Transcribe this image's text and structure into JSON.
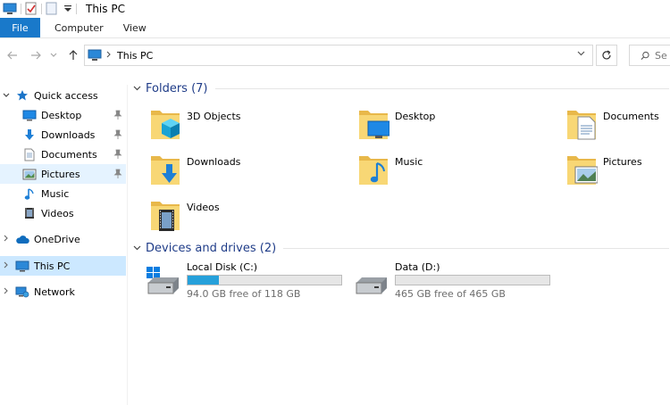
{
  "window": {
    "title": "This PC"
  },
  "ribbon": {
    "tabs": [
      {
        "label": "File"
      },
      {
        "label": "Computer"
      },
      {
        "label": "View"
      }
    ]
  },
  "address": {
    "path": "This PC",
    "search_placeholder": "Se"
  },
  "sidebar": {
    "quick_access": "Quick access",
    "items": [
      {
        "label": "Desktop",
        "icon": "desktop-icon",
        "pinned": true
      },
      {
        "label": "Downloads",
        "icon": "downloads-icon",
        "pinned": true
      },
      {
        "label": "Documents",
        "icon": "documents-icon",
        "pinned": true
      },
      {
        "label": "Pictures",
        "icon": "pictures-icon",
        "pinned": true
      },
      {
        "label": "Music",
        "icon": "music-icon",
        "pinned": false
      },
      {
        "label": "Videos",
        "icon": "videos-icon",
        "pinned": false
      }
    ],
    "onedrive": "OneDrive",
    "this_pc": "This PC",
    "network": "Network"
  },
  "folders_group": {
    "title": "Folders (7)",
    "items": [
      {
        "label": "3D Objects",
        "icon": "3d-objects-icon"
      },
      {
        "label": "Desktop",
        "icon": "desktop-folder-icon"
      },
      {
        "label": "Documents",
        "icon": "documents-folder-icon"
      },
      {
        "label": "Downloads",
        "icon": "downloads-folder-icon"
      },
      {
        "label": "Music",
        "icon": "music-folder-icon"
      },
      {
        "label": "Pictures",
        "icon": "pictures-folder-icon"
      },
      {
        "label": "Videos",
        "icon": "videos-folder-icon"
      }
    ]
  },
  "drives_group": {
    "title": "Devices and drives (2)",
    "items": [
      {
        "label": "Local Disk (C:)",
        "free_text": "94.0 GB free of 118 GB",
        "used_fraction": 0.203
      },
      {
        "label": "Data (D:)",
        "free_text": "465 GB free of 465 GB",
        "used_fraction": 0.0
      }
    ]
  },
  "colors": {
    "accent": "#1979ca",
    "selection": "#cce8ff",
    "drive_fill": "#26a0da",
    "group_title": "#1f3c88",
    "folder_yellow": "#f8d775"
  }
}
